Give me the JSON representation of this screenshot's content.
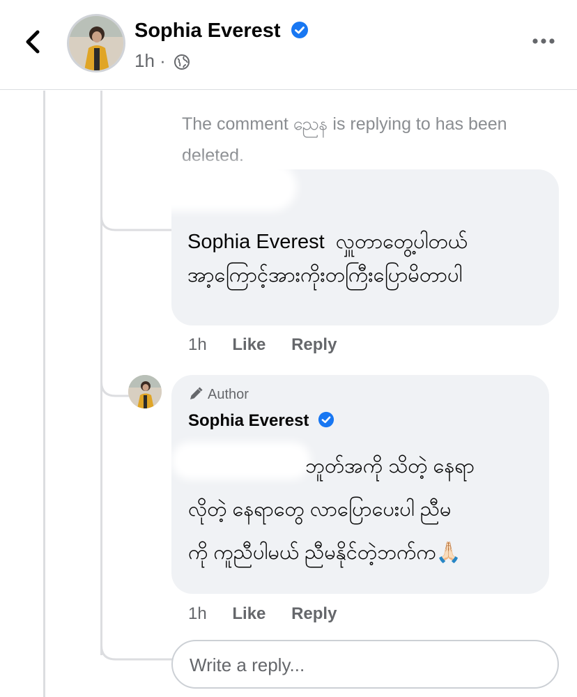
{
  "header": {
    "name": "Sophia Everest",
    "time": "1h",
    "separator": "·",
    "privacy_icon": "globe-icon",
    "back_icon": "chevron-left-icon",
    "more_icon": "more-horizontal-icon"
  },
  "deleted_note": "The comment ညေန is replying to has been deleted.",
  "comment1": {
    "line1": "Sophia Everest  လှူတာတွေ့ပါတယ်",
    "line2": "အာ့ကြောင့်အားကိုးတကြီးပြောမိတာပါ",
    "time": "1h",
    "like": "Like",
    "reply": "Reply"
  },
  "reply": {
    "author_badge": "Author",
    "name": "Sophia Everest",
    "line1": "ဘူတ်အကို သိတဲ့ နေရာ",
    "line2": "လိုတဲ့ နေရာတွေ လာပြောပေးပါ ညီမ",
    "line3": "ကို ကူညီပါမယ် ညီမနိုင်တဲ့ဘက်က🙏🏻",
    "time": "1h",
    "like": "Like",
    "reply": "Reply"
  },
  "composer": {
    "placeholder": "Write a reply..."
  },
  "colors": {
    "verified": "#1877f2",
    "secondary_text": "#65676b",
    "bubble": "#f0f2f5"
  }
}
